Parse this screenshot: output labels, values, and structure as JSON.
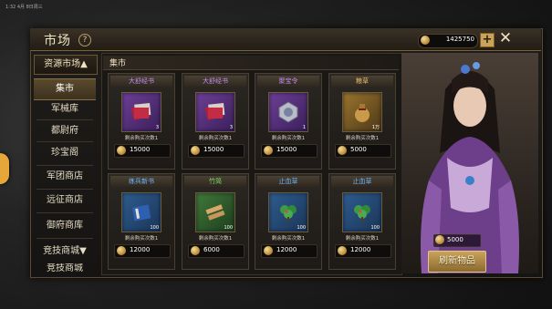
{
  "status_time": "1:32 4月 8日周三",
  "header": {
    "title": "市场",
    "help_icon": "question-icon",
    "gold_amount": "1425750",
    "plus_label": "+",
    "close_label": "✕"
  },
  "sidebar": {
    "header_label": "资源市场▲",
    "items": [
      {
        "label": "集市",
        "active": true
      },
      {
        "label": "军械库"
      },
      {
        "label": "都尉府"
      },
      {
        "label": "珍宝阁"
      },
      {
        "label": "军团商店"
      },
      {
        "label": "远征商店"
      },
      {
        "label": "御府商库"
      },
      {
        "label": "竞技商城▼"
      },
      {
        "label": "竞技商城"
      }
    ]
  },
  "section": {
    "title": "集市"
  },
  "items": [
    {
      "name": "大舒经书",
      "tier": "purple",
      "icon": "red-book-icon",
      "qty": "3",
      "buy_count": "剩余购买次数1",
      "price": "15000"
    },
    {
      "name": "大舒经书",
      "tier": "purple",
      "icon": "red-book-icon",
      "qty": "3",
      "buy_count": "剩余购买次数1",
      "price": "15000"
    },
    {
      "name": "聚宝令",
      "tier": "purple",
      "icon": "silver-medallion-icon",
      "qty": "1",
      "buy_count": "剩余购买次数1",
      "price": "15000"
    },
    {
      "name": "粮草",
      "tier": "gold",
      "icon": "grain-sack-icon",
      "qty": "1万",
      "buy_count": "剩余购买次数1",
      "price": "5000"
    },
    {
      "name": "练兵新书",
      "tier": "blue",
      "icon": "blue-book-icon",
      "qty": "100",
      "buy_count": "剩余购买次数1",
      "price": "12000"
    },
    {
      "name": "竹简",
      "tier": "green",
      "icon": "bamboo-scroll-icon",
      "qty": "100",
      "buy_count": "剩余购买次数1",
      "price": "6000"
    },
    {
      "name": "止血草",
      "tier": "blue",
      "icon": "herb-icon",
      "qty": "100",
      "buy_count": "剩余购买次数1",
      "price": "12000"
    },
    {
      "name": "止血草",
      "tier": "blue",
      "icon": "herb-icon",
      "qty": "100",
      "buy_count": "剩余购买次数1",
      "price": "12000"
    }
  ],
  "portrait": {
    "price": "5000",
    "icon": "merchant-lady-portrait"
  },
  "refresh_button": {
    "label": "刷新物品"
  },
  "colors": {
    "accent_gold": "#c9a35a",
    "panel_bg": "#1a1815",
    "purple_tier": "#c48df0",
    "blue_tier": "#6fb8ff"
  }
}
